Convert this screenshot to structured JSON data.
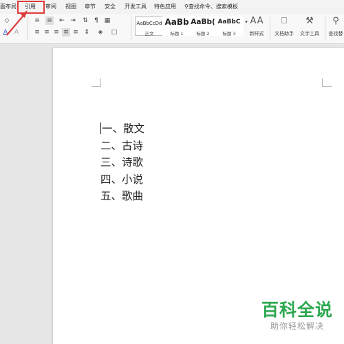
{
  "menu": {
    "items": [
      "面布局",
      "引用",
      "审阅",
      "视图",
      "章节",
      "安全",
      "开发工具",
      "特色应用"
    ],
    "search_label": "查找命令、搜索模板"
  },
  "ribbon": {
    "styles": [
      {
        "sample": "AaBbCcDd",
        "name": "正文"
      },
      {
        "sample": "AaBb",
        "name": "标题 1"
      },
      {
        "sample": "AaBb(",
        "name": "标题 2"
      },
      {
        "sample": "AaBbC",
        "name": "标题 3"
      }
    ],
    "new_style_label": "新样式",
    "doc_helper_label": "文档助手",
    "text_tools_label": "文字工具",
    "find_replace_label": "查找替"
  },
  "document": {
    "list": [
      "一、散文",
      "二、古诗",
      "三、诗歌",
      "四、小说",
      "五、歌曲"
    ]
  },
  "watermark": {
    "main": "百科全说",
    "sub": "助你轻松解决"
  },
  "colors": {
    "highlight": "#e03a3a",
    "watermark": "#2ca84f"
  }
}
